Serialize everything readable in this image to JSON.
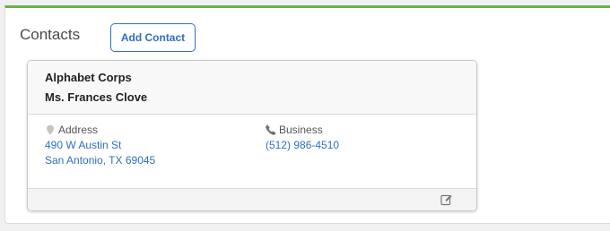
{
  "section": {
    "title": "Contacts",
    "add_button_label": "Add Contact"
  },
  "contact": {
    "company": "Alphabet Corps",
    "name": "Ms. Frances Clove",
    "address": {
      "label": "Address",
      "icon": "map-pin-icon",
      "line1": "490 W Austin St",
      "line2": "San Antonio, TX 69045"
    },
    "phone": {
      "label": "Business",
      "icon": "phone-icon",
      "number": "(512) 986-4510"
    },
    "edit_icon": "edit-icon"
  },
  "colors": {
    "accent_green": "#6ab04c",
    "link_blue": "#2e6fbf"
  }
}
